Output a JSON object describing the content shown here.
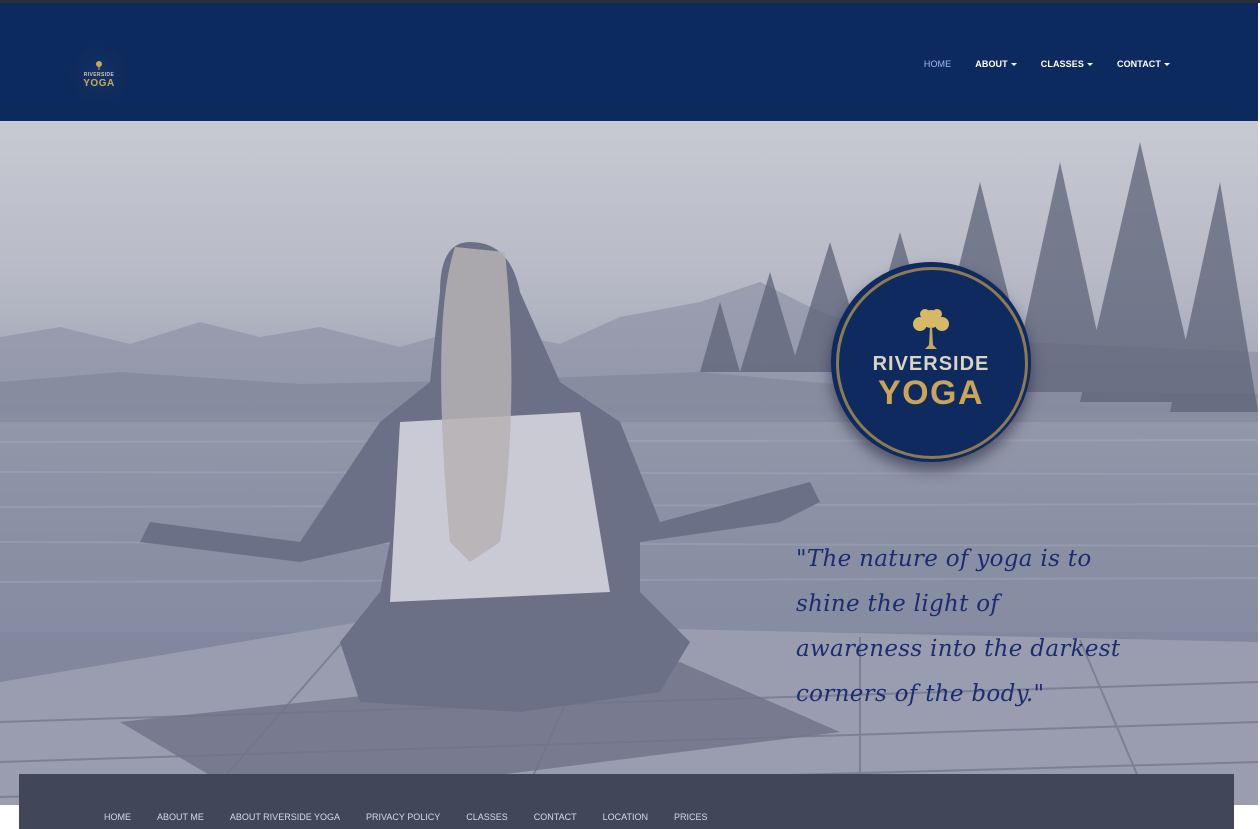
{
  "header": {
    "logo": {
      "line1": "RIVERSIDE",
      "line2": "YOGA",
      "icon": "tree-icon"
    },
    "nav": [
      {
        "label": "HOME",
        "active": true,
        "dropdown": false
      },
      {
        "label": "ABOUT",
        "active": false,
        "dropdown": true
      },
      {
        "label": "CLASSES",
        "active": false,
        "dropdown": true
      },
      {
        "label": "CONTACT",
        "active": false,
        "dropdown": true
      }
    ]
  },
  "hero": {
    "logo": {
      "line1": "RIVERSIDE",
      "line2": "YOGA",
      "icon": "tree-icon"
    },
    "quote": "\"The nature of yoga is to shine the light of awareness into the darkest corners of the body.\""
  },
  "footer": {
    "links": [
      "HOME",
      "ABOUT ME",
      "ABOUT RIVERSIDE YOGA",
      "PRIVACY POLICY",
      "CLASSES",
      "CONTACT",
      "LOCATION",
      "PRICES"
    ]
  },
  "colors": {
    "navbar": "#0d2a5e",
    "active_link": "#a9b8ee",
    "gold": "#caa45a",
    "footer": "#414659",
    "quote": "#1d2c6e"
  }
}
